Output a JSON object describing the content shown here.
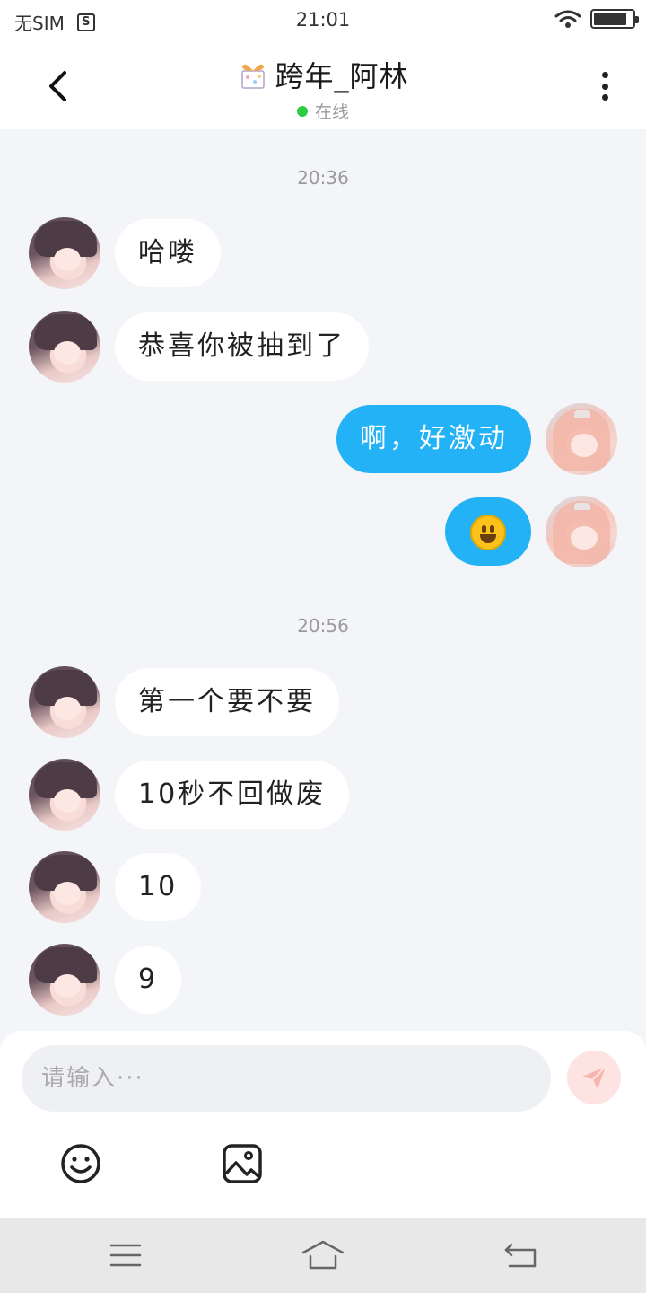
{
  "status_bar": {
    "sim_text": "无SIM",
    "sim_badge": "S",
    "time": "21:01",
    "battery_level": 0.85
  },
  "header": {
    "title": "跨年_阿林",
    "status": "在线",
    "icons": {
      "back": "back-arrow-icon",
      "gift": "gift-icon",
      "more": "more-vertical-icon"
    }
  },
  "chat": {
    "timestamps": [
      "20:36",
      "20:56"
    ],
    "messages": [
      {
        "side": "left",
        "text": "哈喽"
      },
      {
        "side": "left",
        "text": "恭喜你被抽到了"
      },
      {
        "side": "right",
        "text": "啊，好激动"
      },
      {
        "side": "right",
        "text": "",
        "emoji": "smiley-emoji"
      },
      {
        "side": "left",
        "text": "第一个要不要"
      },
      {
        "side": "left",
        "text": "10秒不回做废"
      },
      {
        "side": "left",
        "text": "10"
      },
      {
        "side": "left",
        "text": "9"
      }
    ]
  },
  "composer": {
    "placeholder": "请输入···",
    "icons": {
      "send": "send-icon",
      "emoji": "emoji-icon",
      "image": "image-icon"
    }
  },
  "nav_bar": {
    "icons": [
      "menu-icon",
      "home-icon",
      "back-icon"
    ]
  },
  "colors": {
    "accent_bubble": "#22b2f5",
    "online": "#2ecc40",
    "send_disabled": "#fde3e1",
    "background": "#f3f5f8"
  }
}
